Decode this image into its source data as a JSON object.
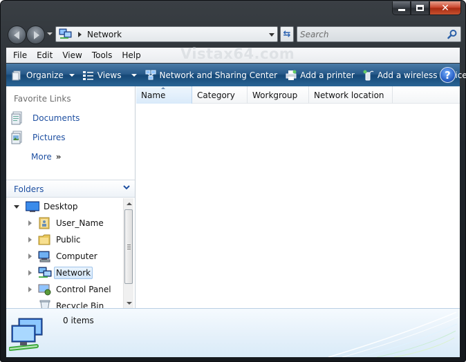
{
  "window": {
    "caption_buttons": [
      "minimize",
      "maximize",
      "close"
    ]
  },
  "address_bar": {
    "location": "Network",
    "icon": "network-icon"
  },
  "search": {
    "placeholder": "Search"
  },
  "menu": {
    "items": [
      "File",
      "Edit",
      "View",
      "Tools",
      "Help"
    ],
    "watermark": "Vistax64.com"
  },
  "commandbar": {
    "items": [
      {
        "label": "Organize",
        "icon": "organize-icon",
        "dropdown": true
      },
      {
        "label": "Views",
        "icon": "views-icon",
        "dropdown": true
      },
      {
        "label": "Network and Sharing Center",
        "icon": "network-center-icon",
        "dropdown": false
      },
      {
        "label": "Add a printer",
        "icon": "printer-icon",
        "dropdown": false
      },
      {
        "label": "Add a wireless device",
        "icon": "wireless-device-icon",
        "dropdown": false
      }
    ],
    "help": "?"
  },
  "favorites": {
    "title": "Favorite Links",
    "links": [
      {
        "label": "Documents",
        "icon": "documents-icon"
      },
      {
        "label": "Pictures",
        "icon": "pictures-icon"
      },
      {
        "label": "More",
        "icon": "double-chevron-icon"
      }
    ]
  },
  "folders": {
    "title": "Folders",
    "items": [
      {
        "label": "Desktop",
        "icon": "desktop-icon",
        "expanded": true,
        "level": 0
      },
      {
        "label": "User_Name",
        "icon": "user-folder-icon",
        "expanded": false,
        "level": 1
      },
      {
        "label": "Public",
        "icon": "folder-icon",
        "expanded": false,
        "level": 1
      },
      {
        "label": "Computer",
        "icon": "computer-icon",
        "expanded": false,
        "level": 1
      },
      {
        "label": "Network",
        "icon": "network-icon",
        "expanded": false,
        "level": 1,
        "selected": true
      },
      {
        "label": "Control Panel",
        "icon": "control-panel-icon",
        "expanded": false,
        "level": 1
      },
      {
        "label": "Recycle Bin",
        "icon": "recycle-bin-icon",
        "expanded": false,
        "level": 1
      }
    ]
  },
  "columns": [
    "Name",
    "Category",
    "Workgroup",
    "Network location"
  ],
  "sorted_column": "Name",
  "details_pane": {
    "text": "0 items",
    "icon": "network-large-icon"
  }
}
